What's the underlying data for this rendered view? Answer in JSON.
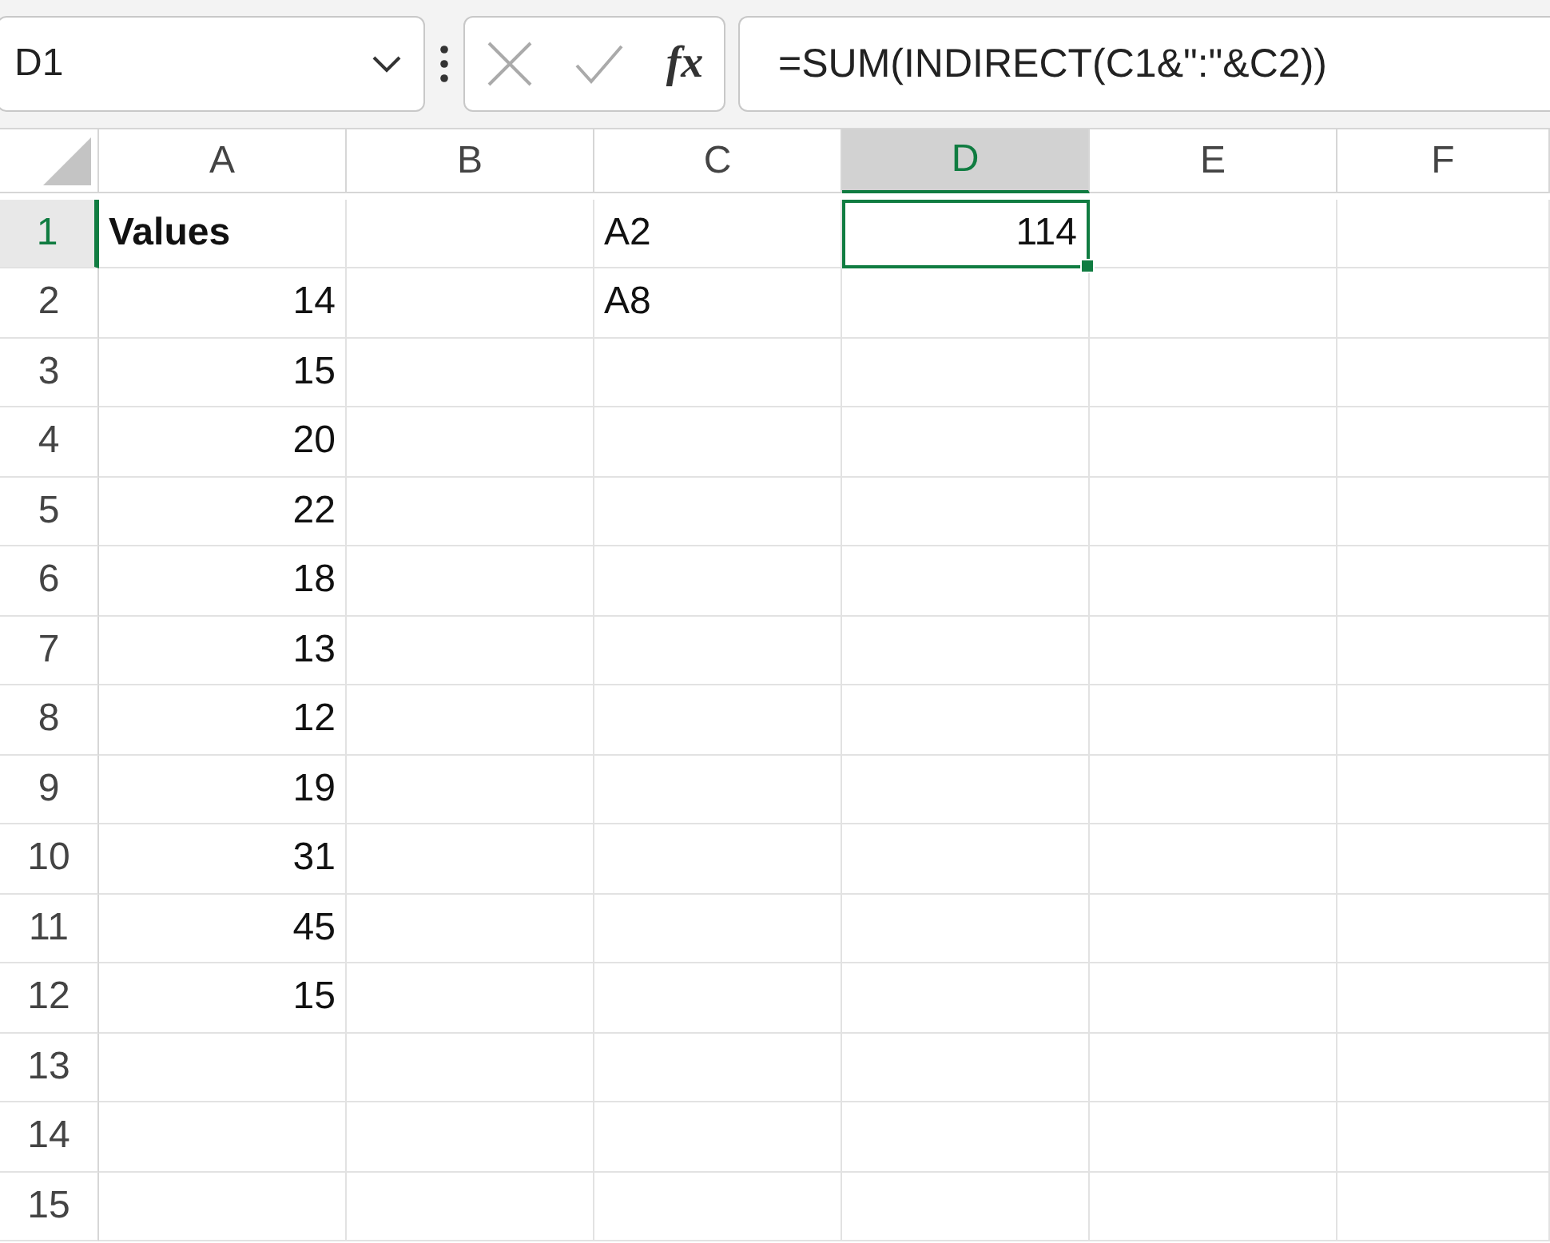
{
  "formula_bar": {
    "name_box": "D1",
    "function_label": "fx",
    "formula": "=SUM(INDIRECT(C1&\":\"&C2))"
  },
  "columns": [
    {
      "label": "A",
      "selected": false
    },
    {
      "label": "B",
      "selected": false
    },
    {
      "label": "C",
      "selected": false
    },
    {
      "label": "D",
      "selected": true
    },
    {
      "label": "E",
      "selected": false
    },
    {
      "label": "F",
      "selected": false
    }
  ],
  "rows": [
    {
      "label": "1",
      "selected": true,
      "cells": [
        {
          "kind": "text",
          "text": "Values",
          "bold": true,
          "selected": false
        },
        {
          "kind": "empty",
          "selected": false
        },
        {
          "kind": "text",
          "text": "A2",
          "selected": false
        },
        {
          "kind": "number",
          "text": "114",
          "selected": true
        },
        {
          "kind": "empty",
          "selected": false
        },
        {
          "kind": "empty",
          "selected": false
        }
      ]
    },
    {
      "label": "2",
      "selected": false,
      "cells": [
        {
          "kind": "number",
          "text": "14",
          "selected": false
        },
        {
          "kind": "empty",
          "selected": false
        },
        {
          "kind": "text",
          "text": "A8",
          "selected": false
        },
        {
          "kind": "empty",
          "selected": false
        },
        {
          "kind": "empty",
          "selected": false
        },
        {
          "kind": "empty",
          "selected": false
        }
      ]
    },
    {
      "label": "3",
      "selected": false,
      "cells": [
        {
          "kind": "number",
          "text": "15",
          "selected": false
        }
      ]
    },
    {
      "label": "4",
      "selected": false,
      "cells": [
        {
          "kind": "number",
          "text": "20",
          "selected": false
        }
      ]
    },
    {
      "label": "5",
      "selected": false,
      "cells": [
        {
          "kind": "number",
          "text": "22",
          "selected": false
        }
      ]
    },
    {
      "label": "6",
      "selected": false,
      "cells": [
        {
          "kind": "number",
          "text": "18",
          "selected": false
        }
      ]
    },
    {
      "label": "7",
      "selected": false,
      "cells": [
        {
          "kind": "number",
          "text": "13",
          "selected": false
        }
      ]
    },
    {
      "label": "8",
      "selected": false,
      "cells": [
        {
          "kind": "number",
          "text": "12",
          "selected": false
        }
      ]
    },
    {
      "label": "9",
      "selected": false,
      "cells": [
        {
          "kind": "number",
          "text": "19",
          "selected": false
        }
      ]
    },
    {
      "label": "10",
      "selected": false,
      "cells": [
        {
          "kind": "number",
          "text": "31",
          "selected": false
        }
      ]
    },
    {
      "label": "11",
      "selected": false,
      "cells": [
        {
          "kind": "number",
          "text": "45",
          "selected": false
        }
      ]
    },
    {
      "label": "12",
      "selected": false,
      "cells": [
        {
          "kind": "number",
          "text": "15",
          "selected": false
        }
      ]
    },
    {
      "label": "13",
      "selected": false,
      "cells": []
    },
    {
      "label": "14",
      "selected": false,
      "cells": []
    },
    {
      "label": "15",
      "selected": false,
      "cells": []
    }
  ]
}
